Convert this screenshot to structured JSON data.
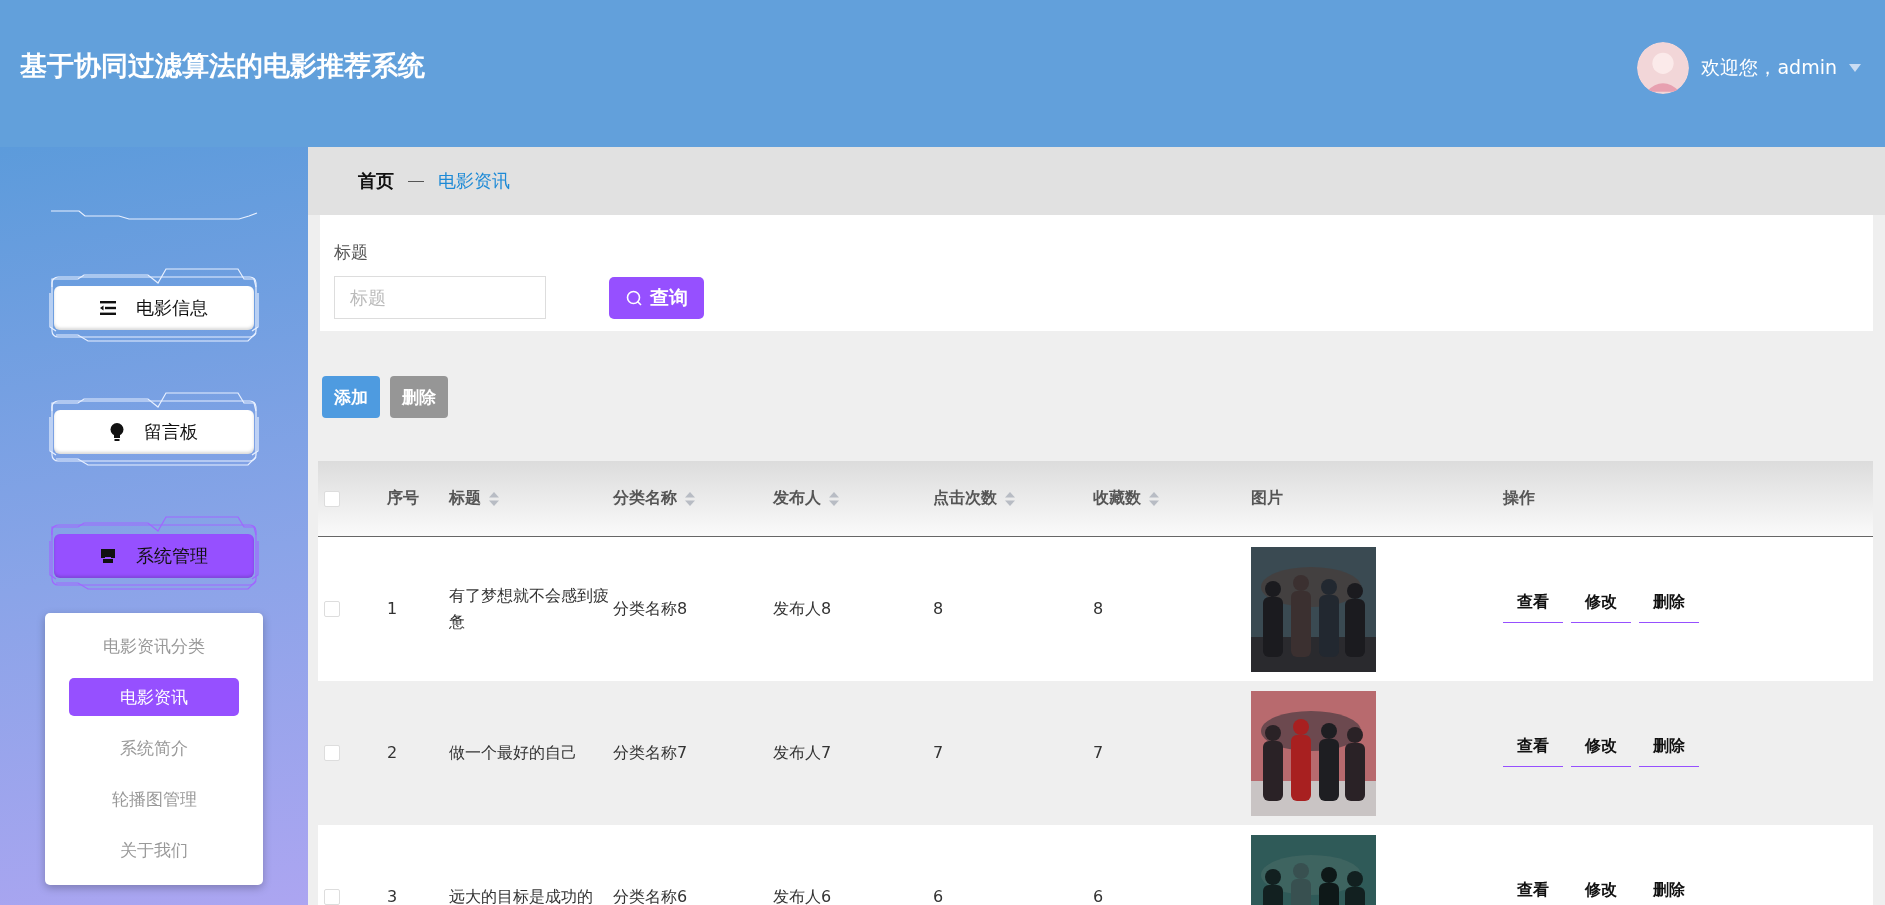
{
  "header": {
    "title": "基于协同过滤算法的电影推荐系统",
    "greeting": "欢迎您，admin"
  },
  "sidebar": {
    "items": [
      {
        "label": "电影信息",
        "selected": false
      },
      {
        "label": "留言板",
        "selected": false
      },
      {
        "label": "系统管理",
        "selected": true
      }
    ],
    "submenu": [
      {
        "label": "电影资讯分类",
        "selected": false
      },
      {
        "label": "电影资讯",
        "selected": true
      },
      {
        "label": "系统简介",
        "selected": false
      },
      {
        "label": "轮播图管理",
        "selected": false
      },
      {
        "label": "关于我们",
        "selected": false
      }
    ]
  },
  "breadcrumb": [
    {
      "label": "首页",
      "current": false
    },
    {
      "label": "电影资讯",
      "current": true
    }
  ],
  "search": {
    "label": "标题",
    "placeholder": "标题",
    "button": "查询"
  },
  "actions": [
    {
      "label": "添加",
      "kind": "add"
    },
    {
      "label": "删除",
      "kind": "delete"
    }
  ],
  "table": {
    "all_checked": false,
    "columns": [
      {
        "label": "序号",
        "sortable": false
      },
      {
        "label": "标题",
        "sortable": true
      },
      {
        "label": "分类名称",
        "sortable": true
      },
      {
        "label": "发布人",
        "sortable": true
      },
      {
        "label": "点击次数",
        "sortable": true
      },
      {
        "label": "收藏数",
        "sortable": true
      },
      {
        "label": "图片",
        "sortable": false
      },
      {
        "label": "操作",
        "sortable": false
      }
    ],
    "rows": [
      {
        "checked": false,
        "cells": [
          "1",
          "有了梦想就不会感到疲惫",
          "分类名称8",
          "发布人8",
          "8",
          "8"
        ],
        "actions": [
          "查看",
          "修改",
          "删除"
        ]
      },
      {
        "checked": false,
        "cells": [
          "2",
          "做一个最好的自己",
          "分类名称7",
          "发布人7",
          "7",
          "7"
        ],
        "actions": [
          "查看",
          "修改",
          "删除"
        ]
      },
      {
        "checked": false,
        "cells": [
          "3",
          "远大的目标是成功的",
          "分类名称6",
          "发布人6",
          "6",
          "6"
        ],
        "actions": [
          "查看",
          "修改",
          "删除"
        ]
      }
    ]
  }
}
